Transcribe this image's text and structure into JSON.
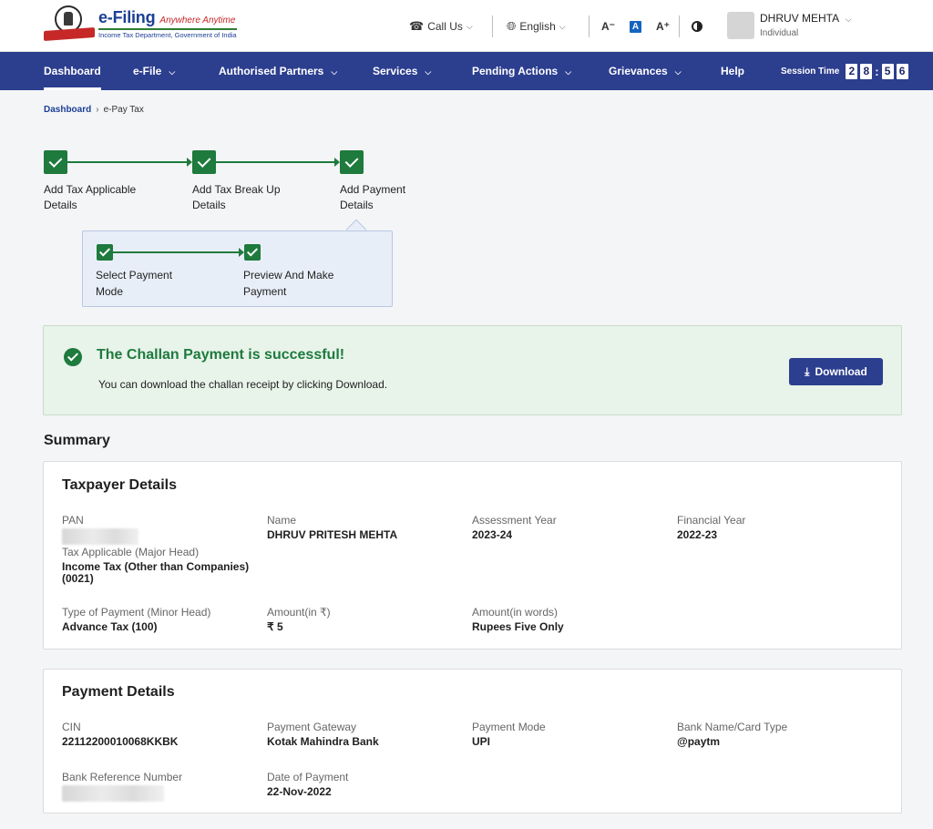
{
  "header": {
    "logo_title": "e-Filing",
    "logo_tagline": "Anywhere Anytime",
    "logo_subtitle": "Income Tax Department, Government of India",
    "call_us": "Call Us",
    "language": "English",
    "font_decrease": "A⁻",
    "font_default": "A",
    "font_increase": "A⁺",
    "user_name": "DHRUV MEHTA",
    "user_role": "Individual",
    "icons": {
      "call": "phone-icon",
      "language": "globe-icon",
      "contrast": "contrast-icon"
    }
  },
  "nav": {
    "items": [
      {
        "label": "Dashboard",
        "active": true
      },
      {
        "label": "e-File",
        "dropdown": true
      },
      {
        "label": "Authorised Partners",
        "dropdown": true
      },
      {
        "label": "Services",
        "dropdown": true
      },
      {
        "label": "Pending Actions",
        "dropdown": true
      },
      {
        "label": "Grievances",
        "dropdown": true
      },
      {
        "label": "Help"
      }
    ],
    "session_label": "Session Time",
    "session_digits": [
      "2",
      "8",
      "5",
      "6"
    ]
  },
  "breadcrumb": {
    "root": "Dashboard",
    "current": "e-Pay Tax"
  },
  "stepper": {
    "steps": [
      {
        "label_line1": "Add Tax Applicable",
        "label_line2": "Details"
      },
      {
        "label_line1": "Add Tax Break Up",
        "label_line2": "Details"
      },
      {
        "label_line1": "Add Payment",
        "label_line2": "Details"
      }
    ],
    "substeps": [
      {
        "label_line1": "Select Payment",
        "label_line2": "Mode"
      },
      {
        "label_line1": "Preview And Make",
        "label_line2": "Payment"
      }
    ]
  },
  "success": {
    "title": "The Challan Payment is successful!",
    "message": "You can download the challan receipt by clicking Download.",
    "download_label": "Download"
  },
  "summary": {
    "title": "Summary",
    "taxpayer": {
      "title": "Taxpayer Details",
      "pan_label": "PAN",
      "name_label": "Name",
      "name": "DHRUV PRITESH MEHTA",
      "ay_label": "Assessment Year",
      "ay": "2023-24",
      "fy_label": "Financial Year",
      "fy": "2022-23",
      "major_head_label": "Tax Applicable (Major Head)",
      "major_head_line1": "Income Tax (Other than Companies)",
      "major_head_line2": "(0021)",
      "minor_head_label": "Type of Payment (Minor Head)",
      "minor_head": "Advance Tax (100)",
      "amount_label": "Amount(in ₹)",
      "amount": "₹ 5",
      "amount_words_label": "Amount(in words)",
      "amount_words": "Rupees Five Only"
    },
    "payment": {
      "title": "Payment Details",
      "cin_label": "CIN",
      "cin": "22112200010068KKBK",
      "gateway_label": "Payment Gateway",
      "gateway": "Kotak Mahindra Bank",
      "mode_label": "Payment Mode",
      "mode": "UPI",
      "bank_label": "Bank Name/Card Type",
      "bank": "@paytm",
      "ref_label": "Bank Reference Number",
      "date_label": "Date of Payment",
      "date": "22-Nov-2022"
    }
  },
  "colors": {
    "nav_bg": "#2c3e8e",
    "success_green": "#1e7a3d",
    "success_bg": "#e8f3ea",
    "brand_blue": "#1c3f94",
    "ribbon_red": "#c62828"
  }
}
